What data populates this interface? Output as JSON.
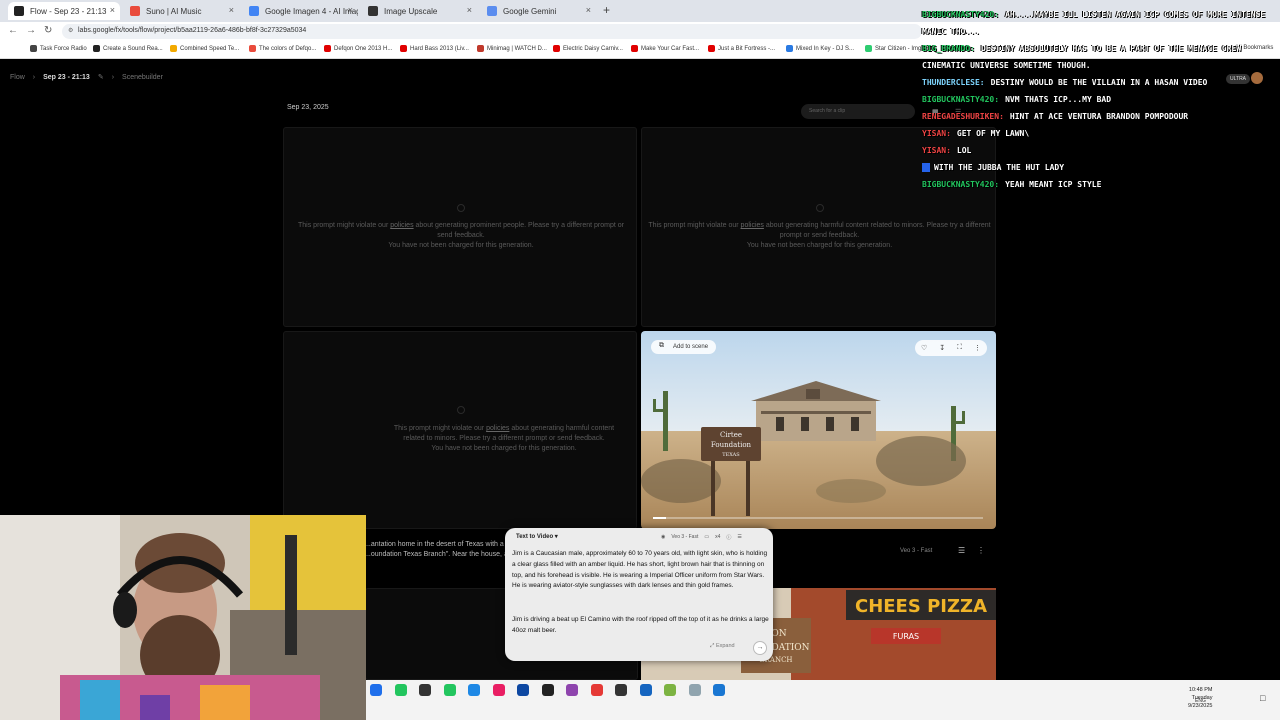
{
  "browser": {
    "tabs": [
      {
        "title": "Flow - Sep 23 - 21:13",
        "active": true,
        "color": "#222222"
      },
      {
        "title": "Suno | AI Music",
        "active": false,
        "color": "#e94b3c"
      },
      {
        "title": "Google Imagen 4 - AI Image Ge...",
        "active": false,
        "color": "#4285f4"
      },
      {
        "title": "Image Upscale",
        "active": false,
        "color": "#333333"
      },
      {
        "title": "Google Gemini",
        "active": false,
        "color": "#5b8def"
      }
    ],
    "url": "labs.google/fx/tools/flow/project/b5aa2119-26a6-486b-bf8f-3c27329a5034",
    "bookmarks": [
      {
        "label": "Task Force Radio",
        "color": "#444444"
      },
      {
        "label": "Create a Sound Rea...",
        "color": "#222222"
      },
      {
        "label": "Combined Speed Te...",
        "color": "#f2a900"
      },
      {
        "label": "The colors of Defqo...",
        "color": "#e94b3c"
      },
      {
        "label": "Defqon One 2013 H...",
        "color": "#e00000"
      },
      {
        "label": "Hard Bass 2013 (Liv...",
        "color": "#e00000"
      },
      {
        "label": "Minimag | WATCH D...",
        "color": "#c0392b"
      },
      {
        "label": "Electric Daisy Carniv...",
        "color": "#e00000"
      },
      {
        "label": "Make Your Car Fast...",
        "color": "#e00000"
      },
      {
        "label": "Just a Bit Fortress -...",
        "color": "#e00000"
      },
      {
        "label": "Mixed In Key - DJ S...",
        "color": "#2a7ae2"
      },
      {
        "label": "Star Citizen - Imgur",
        "color": "#2ecc71"
      }
    ],
    "all_bookmarks": "All Bookmarks"
  },
  "app": {
    "breadcrumb": {
      "root": "Flow",
      "project": "Sep 23 - 21:13",
      "section": "Scenebuilder"
    },
    "date_label": "Sep 23, 2025",
    "search_placeholder": "Search for a clip",
    "plan_badge": "ULTRA",
    "violation_prominent": {
      "pre": "This prompt might violate our ",
      "link": "policies",
      "post": " about generating prominent people. Please try a different prompt or send feedback.",
      "note": "You have not been charged for this generation."
    },
    "violation_minors": {
      "pre": "This prompt might violate our ",
      "link": "policies",
      "post": " about generating harmful content related to minors. Please try a different prompt or send feedback.",
      "note": "You have not been charged for this generation."
    },
    "video_card": {
      "add_to_scene": "Add to scene",
      "sign_lines": [
        "Cirtee",
        "Foundation",
        "TEXAS"
      ],
      "progress": 0.04
    },
    "card_prompt_snippet": {
      "line1": "...antation home in the desert of Texas with a",
      "line2": "...oundation Texas Branch\". Near the house, a"
    },
    "model_label": "Veo 3 - Fast",
    "pizza_sign": "CHEES PIZZA",
    "pizza_lower": [
      "FURAS",
      "TON",
      "FOUNDATION",
      "BRANCH"
    ]
  },
  "prompt_panel": {
    "mode": "Text to Video",
    "model": "Veo 3 - Fast",
    "count": "x4",
    "paragraph1": "Jim is a Caucasian male, approximately 60 to 70 years old, with light skin, who is holding a clear glass filled with an amber liquid. He has short, light brown hair that is thinning on top, and his forehead is visible. He is wearing a Imperial Officer uniform from Star Wars. He is wearing aviator-style sunglasses with dark lenses and thin gold frames.",
    "paragraph2": "Jim is driving a beat up El Camino with the roof ripped off the top of it as he drinks a large 40oz malt beer.",
    "expand": "Expand"
  },
  "chat": [
    {
      "user": "Bigbucknasty420:",
      "msg": "Ah....maybe ill listen again ICP comes of more intense",
      "color": "#22c55e"
    },
    {
      "user": "",
      "msg": "manic tho...",
      "color": "#ffffff"
    },
    {
      "user": "Big_Brando:",
      "msg": "Destiny absolutely has to be a part of the Menace Crew",
      "color": "#22c55e"
    },
    {
      "user": "",
      "msg": "cinematic universe sometime though.",
      "color": "#ffffff"
    },
    {
      "user": "Thunderclese:",
      "msg": "Destiny would be the villain in a hasan video",
      "color": "#7dd3fc"
    },
    {
      "user": "Bigbucknasty420:",
      "msg": "NVM THATS ICP...MY BAD",
      "color": "#22c55e"
    },
    {
      "user": "RenegadeShuriken:",
      "msg": "hint at ace ventura brandon pompodour",
      "color": "#ef4444"
    },
    {
      "user": "Yisan:",
      "msg": "get of my lawn\\",
      "color": "#ef4444"
    },
    {
      "user": "Yisan:",
      "msg": "lol",
      "color": "#ef4444"
    },
    {
      "user": "",
      "msg": "with the Jubba the hut lady",
      "color": "#2563eb"
    },
    {
      "user": "Bigbucknasty420:",
      "msg": "Yeah meant ICP style",
      "color": "#22c55e"
    }
  ],
  "taskbar": {
    "time": "10:48 PM",
    "day": "Tuesday",
    "date": "9/23/2025",
    "lang": "ENG",
    "icon_colors": [
      "#1f6feb",
      "#22c55e",
      "#333333",
      "#22c55e",
      "#1e88e5",
      "#e91e63",
      "#0d47a1",
      "#222222",
      "#8e44ad",
      "#e53935",
      "#333333",
      "#1565c0",
      "#7cb342",
      "#90a4ae",
      "#1976d2"
    ]
  }
}
